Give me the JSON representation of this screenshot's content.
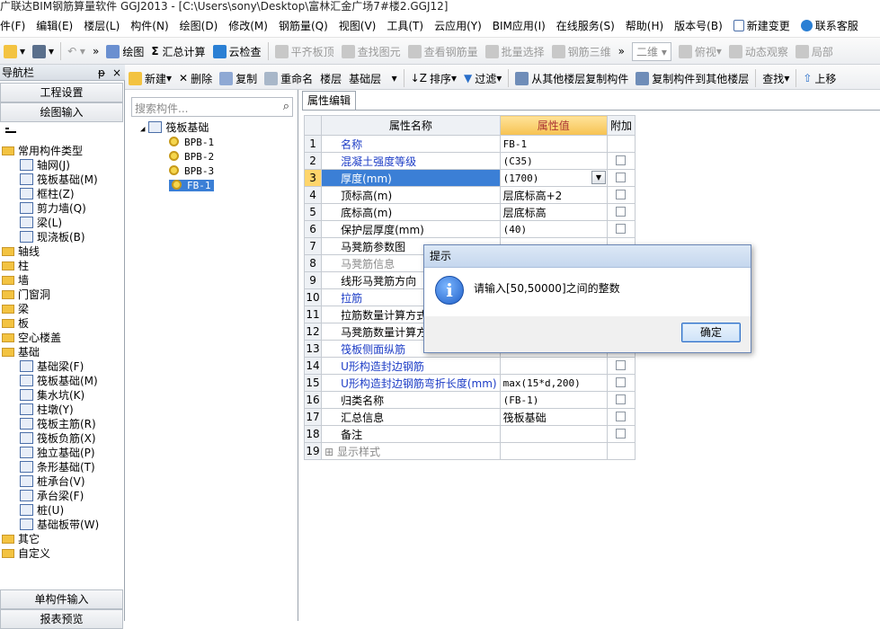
{
  "window": {
    "title": "广联达BIM钢筋算量软件 GGJ2013 - [C:\\Users\\sony\\Desktop\\富林汇金广场7#楼2.GGJ12]"
  },
  "menu": [
    "件(F)",
    "编辑(E)",
    "楼层(L)",
    "构件(N)",
    "绘图(D)",
    "修改(M)",
    "钢筋量(Q)",
    "视图(V)",
    "工具(T)",
    "云应用(Y)",
    "BIM应用(I)",
    "在线服务(S)",
    "帮助(H)",
    "版本号(B)",
    "新建变更",
    "联系客服"
  ],
  "toolbar": {
    "draw": "绘图",
    "sum": "汇总计算",
    "cloud_check": "云检查",
    "flat_top": "平齐板顶",
    "find_elem": "查找图元",
    "view_rebar": "查看钢筋量",
    "batch_select": "批量选择",
    "rebar_3d": "钢筋三维",
    "view_mode": "二维",
    "top_view": "俯视",
    "dynamic": "动态观察",
    "local": "局部"
  },
  "nav": {
    "header": "导航栏",
    "pin": "ᵽ",
    "close": "×",
    "project_settings": "工程设置",
    "drawing_input": "绘图输入",
    "single_input": "单构件输入",
    "report": "报表预览",
    "tree": [
      {
        "label": "常用构件类型",
        "kind": "folder",
        "level": 0
      },
      {
        "label": "轴网(J)",
        "kind": "item",
        "level": 1
      },
      {
        "label": "筏板基础(M)",
        "kind": "item",
        "level": 1
      },
      {
        "label": "框柱(Z)",
        "kind": "item",
        "level": 1
      },
      {
        "label": "剪力墙(Q)",
        "kind": "item",
        "level": 1
      },
      {
        "label": "梁(L)",
        "kind": "item",
        "level": 1
      },
      {
        "label": "现浇板(B)",
        "kind": "item",
        "level": 1
      },
      {
        "label": "轴线",
        "kind": "folder",
        "level": 0
      },
      {
        "label": "柱",
        "kind": "folder",
        "level": 0
      },
      {
        "label": "墙",
        "kind": "folder",
        "level": 0
      },
      {
        "label": "门窗洞",
        "kind": "folder",
        "level": 0
      },
      {
        "label": "梁",
        "kind": "folder",
        "level": 0
      },
      {
        "label": "板",
        "kind": "folder",
        "level": 0
      },
      {
        "label": "空心楼盖",
        "kind": "folder",
        "level": 0
      },
      {
        "label": "基础",
        "kind": "folder",
        "level": 0
      },
      {
        "label": "基础梁(F)",
        "kind": "item",
        "level": 1
      },
      {
        "label": "筏板基础(M)",
        "kind": "item",
        "level": 1
      },
      {
        "label": "集水坑(K)",
        "kind": "item",
        "level": 1
      },
      {
        "label": "柱墩(Y)",
        "kind": "item",
        "level": 1
      },
      {
        "label": "筏板主筋(R)",
        "kind": "item",
        "level": 1
      },
      {
        "label": "筏板负筋(X)",
        "kind": "item",
        "level": 1
      },
      {
        "label": "独立基础(P)",
        "kind": "item",
        "level": 1
      },
      {
        "label": "条形基础(T)",
        "kind": "item",
        "level": 1
      },
      {
        "label": "桩承台(V)",
        "kind": "item",
        "level": 1
      },
      {
        "label": "承台梁(F)",
        "kind": "item",
        "level": 1
      },
      {
        "label": "桩(U)",
        "kind": "item",
        "level": 1
      },
      {
        "label": "基础板带(W)",
        "kind": "item",
        "level": 1
      },
      {
        "label": "其它",
        "kind": "folder",
        "level": 0
      },
      {
        "label": "自定义",
        "kind": "folder",
        "level": 0
      }
    ]
  },
  "comp_toolbar": {
    "new": "新建",
    "delete": "删除",
    "copy": "复制",
    "rename": "重命名",
    "floor_label": "楼层",
    "floor_value": "基础层",
    "sort": "排序",
    "filter": "过滤",
    "copy_from": "从其他楼层复制构件",
    "copy_to": "复制构件到其他楼层",
    "find": "查找",
    "up": "上移"
  },
  "comp_list": {
    "search_placeholder": "搜索构件...",
    "root": "筏板基础",
    "items": [
      "BPB-1",
      "BPB-2",
      "BPB-3",
      "FB-1"
    ],
    "selected": "FB-1"
  },
  "prop": {
    "tab": "属性编辑",
    "headers": {
      "name": "属性名称",
      "value": "属性值",
      "extra": "附加"
    },
    "rows": [
      {
        "n": "1",
        "name": "名称",
        "value": "FB-1",
        "blue": true,
        "check": false
      },
      {
        "n": "2",
        "name": "混凝土强度等级",
        "value": "(C35)",
        "blue": true,
        "check": true
      },
      {
        "n": "3",
        "name": "厚度(mm)",
        "value": "(1700)",
        "blue": true,
        "check": true
      },
      {
        "n": "4",
        "name": "顶标高(m)",
        "value": "层底标高+2",
        "blue": false,
        "check": true
      },
      {
        "n": "5",
        "name": "底标高(m)",
        "value": "层底标高",
        "blue": false,
        "check": true
      },
      {
        "n": "6",
        "name": "保护层厚度(mm)",
        "value": "(40)",
        "blue": false,
        "check": true
      },
      {
        "n": "7",
        "name": "马凳筋参数图",
        "value": "",
        "blue": false,
        "check": false
      },
      {
        "n": "8",
        "name": "马凳筋信息",
        "value": "",
        "gray": true,
        "check": false
      },
      {
        "n": "9",
        "name": "线形马凳筋方向",
        "value": "",
        "blue": false,
        "check": false
      },
      {
        "n": "10",
        "name": "拉筋",
        "value": "",
        "blue": true,
        "check": false
      },
      {
        "n": "11",
        "name": "拉筋数量计算方式",
        "value": "",
        "blue": false,
        "check": false
      },
      {
        "n": "12",
        "name": "马凳筋数量计算方式",
        "value": "",
        "blue": false,
        "check": false
      },
      {
        "n": "13",
        "name": "筏板侧面纵筋",
        "value": "",
        "blue": true,
        "check": false
      },
      {
        "n": "14",
        "name": "U形构造封边钢筋",
        "value": "",
        "blue": true,
        "check": true
      },
      {
        "n": "15",
        "name": "U形构造封边钢筋弯折长度(mm)",
        "value": "max(15*d,200)",
        "blue": true,
        "check": true
      },
      {
        "n": "16",
        "name": "归类名称",
        "value": "(FB-1)",
        "blue": false,
        "check": true
      },
      {
        "n": "17",
        "name": "汇总信息",
        "value": "筏板基础",
        "blue": false,
        "check": true
      },
      {
        "n": "18",
        "name": "备注",
        "value": "",
        "blue": false,
        "check": true
      },
      {
        "n": "19",
        "name": "显示样式",
        "value": "",
        "gray": true,
        "check": false,
        "expand": true
      }
    ]
  },
  "dialog": {
    "title": "提示",
    "message": "请输入[50,50000]之间的整数",
    "ok": "确定",
    "icon": "i"
  }
}
